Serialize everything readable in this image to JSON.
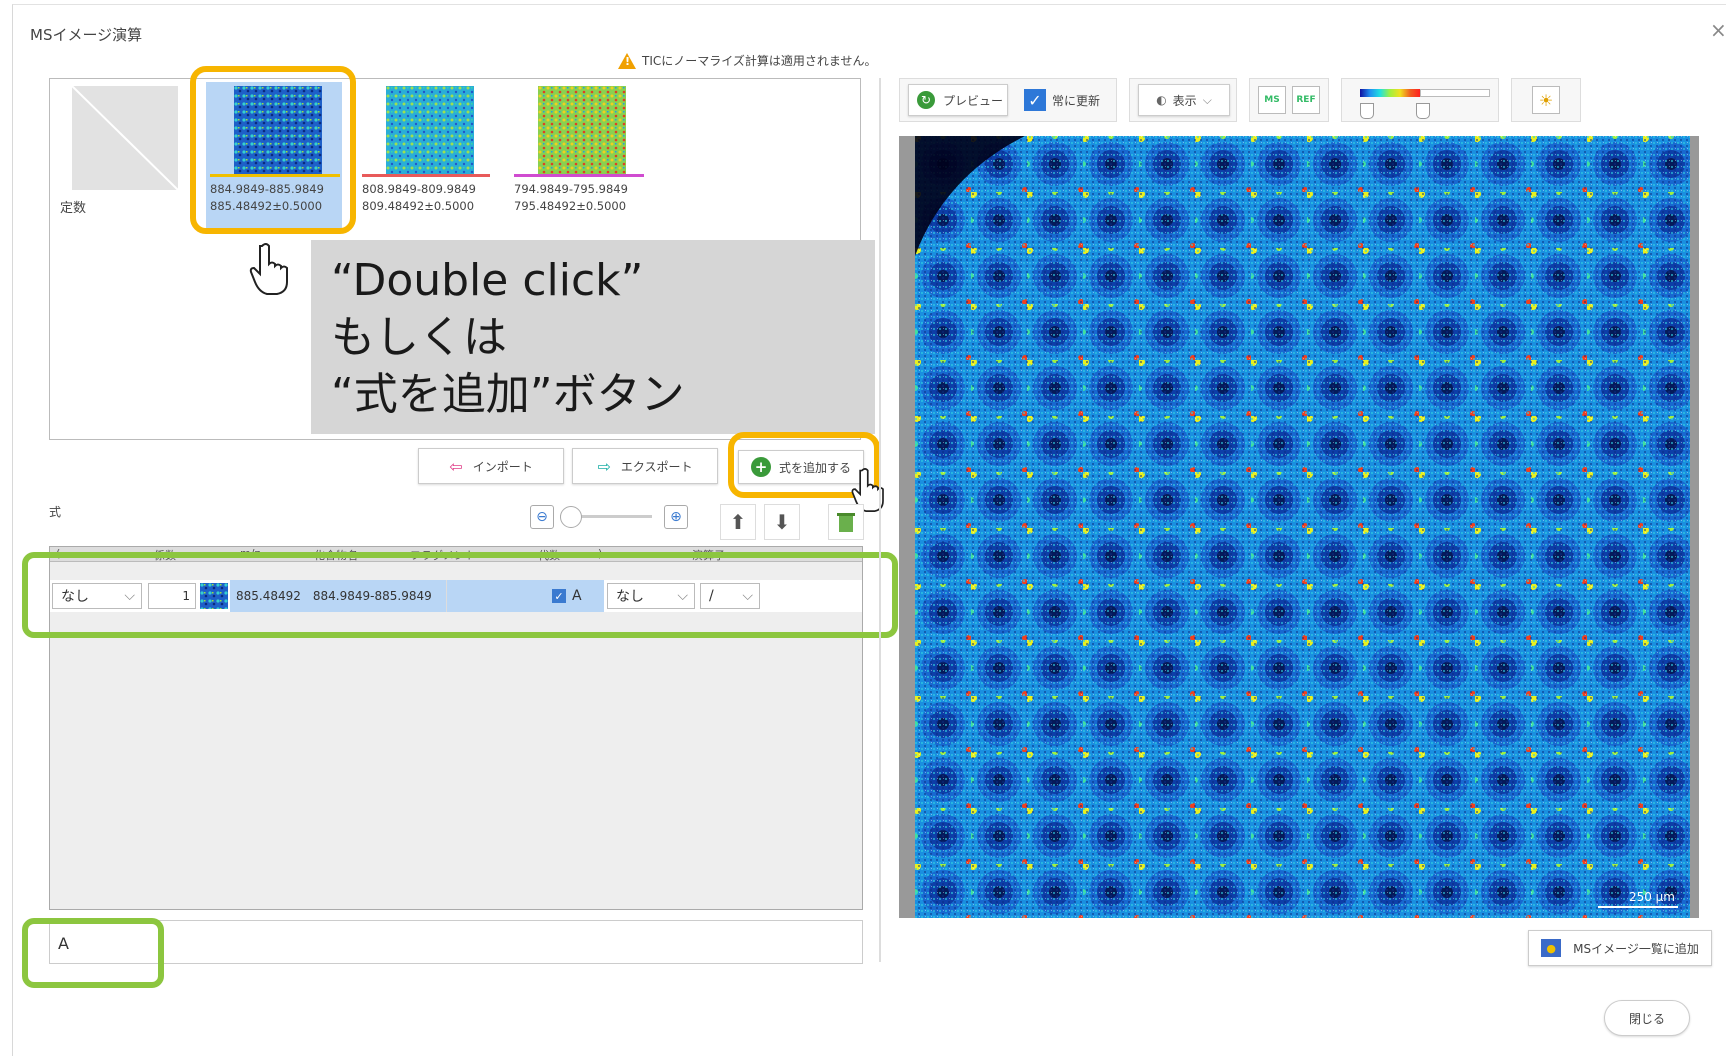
{
  "window": {
    "title": "MSイメージ演算",
    "close_glyph": "×"
  },
  "warning": {
    "text": "TICにノーマライズ計算は適用されません。"
  },
  "thumbnails": [
    {
      "caption1": "定数",
      "caption2": ""
    },
    {
      "caption1": "884.9849-885.9849",
      "caption2": "885.48492±0.5000",
      "underline": "#f0c000"
    },
    {
      "caption1": "808.9849-809.9849",
      "caption2": "809.48492±0.5000",
      "underline": "#e85a5a"
    },
    {
      "caption1": "794.9849-795.9849",
      "caption2": "795.48492±0.5000",
      "underline": "#d04cd0"
    }
  ],
  "annotation": {
    "text": "“Double click”\nもしくは\n“式を追加”ボタン"
  },
  "buttons": {
    "import": "インポート",
    "export": "エクスポート",
    "add_formula": "式を追加する"
  },
  "formula": {
    "label": "式"
  },
  "grid": {
    "headers": [
      "(",
      "係数",
      "",
      "m/z",
      "化合物名",
      "フラグメント",
      "代数",
      ")",
      "演算子"
    ],
    "row": {
      "paren_open": "なし",
      "coefficient": "1",
      "mz": "885.48492",
      "range": "884.9849-885.9849",
      "compound": "",
      "variable_checked": true,
      "variable": "A",
      "paren_close": "なし",
      "operator": "/"
    }
  },
  "result": {
    "expression": "A"
  },
  "preview_toolbar": {
    "preview": "プレビュー",
    "always_update": "常に更新",
    "always_update_checked": true,
    "display": "表示",
    "ms_icon": "MS",
    "ref_icon": "REF"
  },
  "image": {
    "scale_label": "250 µm"
  },
  "footer": {
    "add_to_list": "MSイメージ一覧に追加",
    "close": "閉じる"
  },
  "colors": {
    "orange_highlight": "#f7b500",
    "green_highlight": "#8cc63f",
    "selection": "#b9d6f5"
  }
}
